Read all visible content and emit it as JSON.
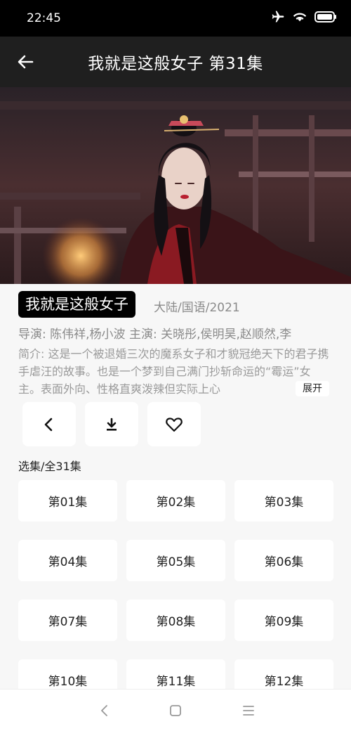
{
  "status_bar": {
    "time": "22:45",
    "icons": [
      "airplane-icon",
      "wifi-icon",
      "battery-icon"
    ]
  },
  "header": {
    "title": "我就是这般女子 第31集"
  },
  "drama": {
    "title": "我就是这般女子",
    "region_language_year": "大陆/国语/2021",
    "credits": "导演: 陈伟祥,杨小波   主演: 关晓彤,侯明昊,赵顺然,李",
    "intro": "简介: 这是一个被退婚三次的魔系女子和才貌冠绝天下的君子携手虐汪的故事。也是一个梦到自己满门抄斩命运的“霉运”女主。表面外向、性格直爽泼辣但实际上心",
    "expand_label": "展开"
  },
  "actions": [
    "back-icon",
    "download-icon",
    "heart-icon"
  ],
  "episodes": {
    "label": "选集/全31集",
    "items": [
      "第01集",
      "第02集",
      "第03集",
      "第04集",
      "第05集",
      "第06集",
      "第07集",
      "第08集",
      "第09集",
      "第10集",
      "第11集",
      "第12集"
    ]
  },
  "colors": {
    "status_bar_bg": "#000000",
    "app_bar_bg": "#1f1f1f",
    "page_bg": "#f7f7f7",
    "badge_bg": "#000000",
    "secondary_text": "#8a8a8a"
  },
  "nav_bar": {
    "icons": [
      "nav-back-icon",
      "nav-home-icon",
      "nav-menu-icon"
    ]
  }
}
